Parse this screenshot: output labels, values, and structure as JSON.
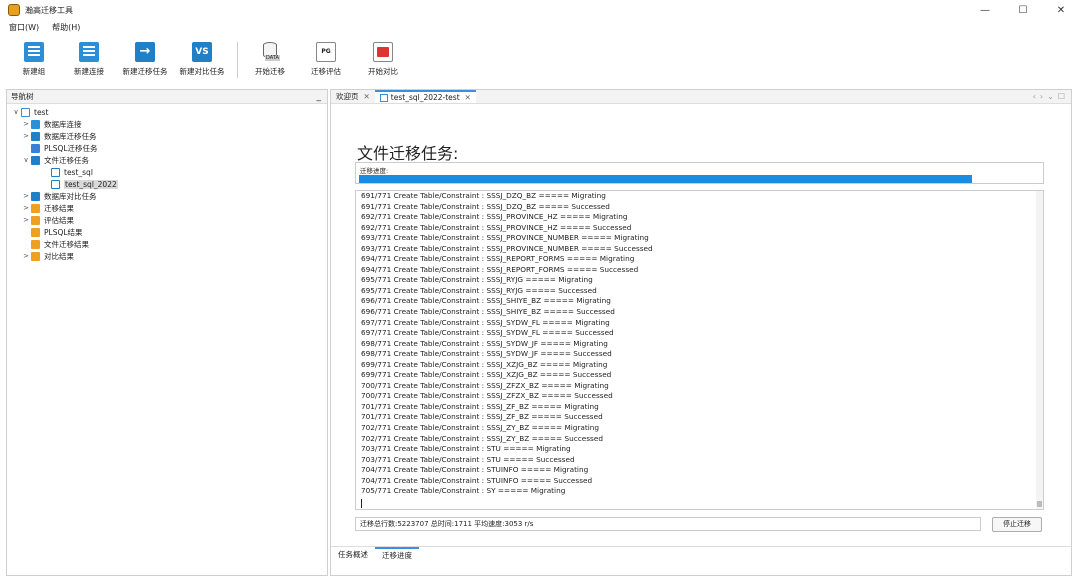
{
  "window": {
    "title": "瀚高迁移工具",
    "controls": [
      "—",
      "☐",
      "✕"
    ]
  },
  "menu": [
    "窗口(W)",
    "帮助(H)"
  ],
  "toolbar": [
    {
      "label": "新建组",
      "icon": "new-group-icon"
    },
    {
      "label": "新建连接",
      "icon": "new-connection-icon"
    },
    {
      "label": "新建迁移任务",
      "icon": "new-migration-task-icon"
    },
    {
      "label": "新建对比任务",
      "icon": "new-compare-task-icon"
    },
    {
      "label": "开始迁移",
      "icon": "start-migration-icon",
      "tag": "DATA"
    },
    {
      "label": "迁移评估",
      "icon": "migration-evaluation-icon",
      "tag": "PG"
    },
    {
      "label": "开始对比",
      "icon": "start-compare-icon"
    }
  ],
  "nav": {
    "title": "导航树",
    "minimize": "_",
    "tree": [
      {
        "label": "test",
        "level": 0,
        "twisty": "∨",
        "icon": "root"
      },
      {
        "label": "数据库连接",
        "level": 1,
        "twisty": ">",
        "icon": "doc"
      },
      {
        "label": "数据库迁移任务",
        "level": 1,
        "twisty": ">",
        "icon": "arrow"
      },
      {
        "label": "PLSQL迁移任务",
        "level": 1,
        "twisty": "",
        "icon": "plsql"
      },
      {
        "label": "文件迁移任务",
        "level": 1,
        "twisty": "∨",
        "icon": "file"
      },
      {
        "label": "test_sql",
        "level": 2,
        "twisty": "",
        "icon": "sub"
      },
      {
        "label": "test_sql_2022",
        "level": 2,
        "twisty": "",
        "icon": "sub",
        "selected": true
      },
      {
        "label": "数据库对比任务",
        "level": 1,
        "twisty": ">",
        "icon": "vs"
      },
      {
        "label": "迁移结果",
        "level": 1,
        "twisty": ">",
        "icon": "orange"
      },
      {
        "label": "评估结果",
        "level": 1,
        "twisty": ">",
        "icon": "orange"
      },
      {
        "label": "PLSQL结果",
        "level": 1,
        "twisty": "",
        "icon": "orange"
      },
      {
        "label": "文件迁移结果",
        "level": 1,
        "twisty": "",
        "icon": "orange"
      },
      {
        "label": "对比结果",
        "level": 1,
        "twisty": ">",
        "icon": "orange"
      }
    ]
  },
  "editor": {
    "tabs": [
      {
        "label": "欢迎页",
        "close": "✕",
        "active": false
      },
      {
        "label": "test_sql_2022-test",
        "close": "✕",
        "active": true
      }
    ],
    "tab_controls": [
      "‹",
      "›",
      "⌄",
      "☐"
    ],
    "page_title": "文件迁移任务:",
    "progress_label": "迁移进度:",
    "progress_fraction": 0.9,
    "log": [
      "691/771 Create Table/Constraint : SSSJ_DZQ_BZ ===== Migrating",
      "691/771 Create Table/Constraint : SSSJ_DZQ_BZ ===== Successed",
      "692/771 Create Table/Constraint : SSSJ_PROVINCE_HZ ===== Migrating",
      "692/771 Create Table/Constraint : SSSJ_PROVINCE_HZ ===== Successed",
      "693/771 Create Table/Constraint : SSSJ_PROVINCE_NUMBER ===== Migrating",
      "693/771 Create Table/Constraint : SSSJ_PROVINCE_NUMBER ===== Successed",
      "694/771 Create Table/Constraint : SSSJ_REPORT_FORMS ===== Migrating",
      "694/771 Create Table/Constraint : SSSJ_REPORT_FORMS ===== Successed",
      "695/771 Create Table/Constraint : SSSJ_RYJG ===== Migrating",
      "695/771 Create Table/Constraint : SSSJ_RYJG ===== Successed",
      "696/771 Create Table/Constraint : SSSJ_SHIYE_BZ ===== Migrating",
      "696/771 Create Table/Constraint : SSSJ_SHIYE_BZ ===== Successed",
      "697/771 Create Table/Constraint : SSSJ_SYDW_FL ===== Migrating",
      "697/771 Create Table/Constraint : SSSJ_SYDW_FL ===== Successed",
      "698/771 Create Table/Constraint : SSSJ_SYDW_JF ===== Migrating",
      "698/771 Create Table/Constraint : SSSJ_SYDW_JF ===== Successed",
      "699/771 Create Table/Constraint : SSSJ_XZJG_BZ ===== Migrating",
      "699/771 Create Table/Constraint : SSSJ_XZJG_BZ ===== Successed",
      "700/771 Create Table/Constraint : SSSJ_ZFZX_BZ ===== Migrating",
      "700/771 Create Table/Constraint : SSSJ_ZFZX_BZ ===== Successed",
      "701/771 Create Table/Constraint : SSSJ_ZF_BZ ===== Migrating",
      "701/771 Create Table/Constraint : SSSJ_ZF_BZ ===== Successed",
      "702/771 Create Table/Constraint : SSSJ_ZY_BZ ===== Migrating",
      "702/771 Create Table/Constraint : SSSJ_ZY_BZ ===== Successed",
      "703/771 Create Table/Constraint : STU ===== Migrating",
      "703/771 Create Table/Constraint : STU ===== Successed",
      "704/771 Create Table/Constraint : STUINFO ===== Migrating",
      "704/771 Create Table/Constraint : STUINFO ===== Successed",
      "705/771 Create Table/Constraint : SY ===== Migrating"
    ],
    "status_text": "迁移总行数:5223707  总时间:1711  平均速度:3053 r/s",
    "stop_button": "停止迁移",
    "bottom_tabs": [
      {
        "label": "任务概述",
        "active": false
      },
      {
        "label": "迁移进度",
        "active": true
      }
    ]
  },
  "colors": {
    "accent": "#1c8be0",
    "icon_blue": "#1f7fc7",
    "icon_orange": "#f0a020"
  }
}
